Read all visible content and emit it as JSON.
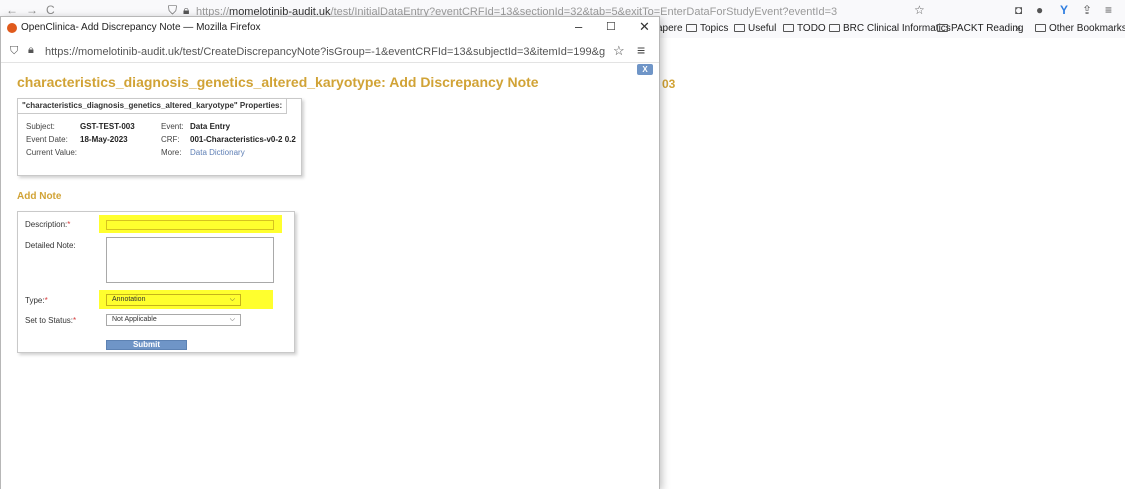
{
  "background_browser": {
    "url_prefix": "https://",
    "url_domain": "momelotinib-audit.uk",
    "url_path": "/test/InitialDataEntry?eventCRFId=13&sectionId=32&tab=5&exitTo=EnterDataForStudyEvent?eventId=3",
    "bookmarks": [
      {
        "label": "apere",
        "folder": false
      },
      {
        "label": "Topics",
        "folder": true
      },
      {
        "label": "Useful",
        "folder": true
      },
      {
        "label": "TODO",
        "folder": true
      },
      {
        "label": "BRC Clinical Informatics",
        "folder": true
      },
      {
        "label": "PACKT Reading",
        "folder": true
      }
    ],
    "more_bookmarks_label": "Other Bookmarks",
    "partial_heading": "03"
  },
  "popup": {
    "window_title": "OpenClinica- Add Discrepancy Note — Mozilla Firefox",
    "url": "https://momelotinib-audit.uk/test/CreateDiscrepancyNote?isGroup=-1&eventCRFId=13&subjectId=3&itemId=199&groupLabel=&sec",
    "close_label": "X",
    "page_title": "characteristics_diagnosis_genetics_altered_karyotype: Add Discrepancy Note",
    "properties": {
      "tab_label": "\"characteristics_diagnosis_genetics_altered_karyotype\" Properties:",
      "subject_label": "Subject:",
      "subject_value": "GST-TEST-003",
      "event_label": "Event:",
      "event_value": "Data Entry",
      "event_date_label": "Event Date:",
      "event_date_value": "18-May-2023",
      "crf_label": "CRF:",
      "crf_value": "001-Characteristics-v0-2 0.2",
      "current_value_label": "Current Value:",
      "more_label": "More:",
      "more_link": "Data Dictionary"
    },
    "add_note": {
      "heading": "Add Note",
      "description_label": "Description:",
      "description_value": "",
      "detailed_note_label": "Detailed Note:",
      "detailed_note_value": "",
      "type_label": "Type:",
      "type_selected": "Annotation",
      "status_label": "Set to Status:",
      "status_selected": "Not Applicable",
      "required_marker": "*",
      "submit_label": "Submit"
    }
  },
  "colors": {
    "heading": "#d1a336",
    "highlight": "#ffff2e",
    "button": "#6f95c7",
    "required": "#d63b3b"
  }
}
